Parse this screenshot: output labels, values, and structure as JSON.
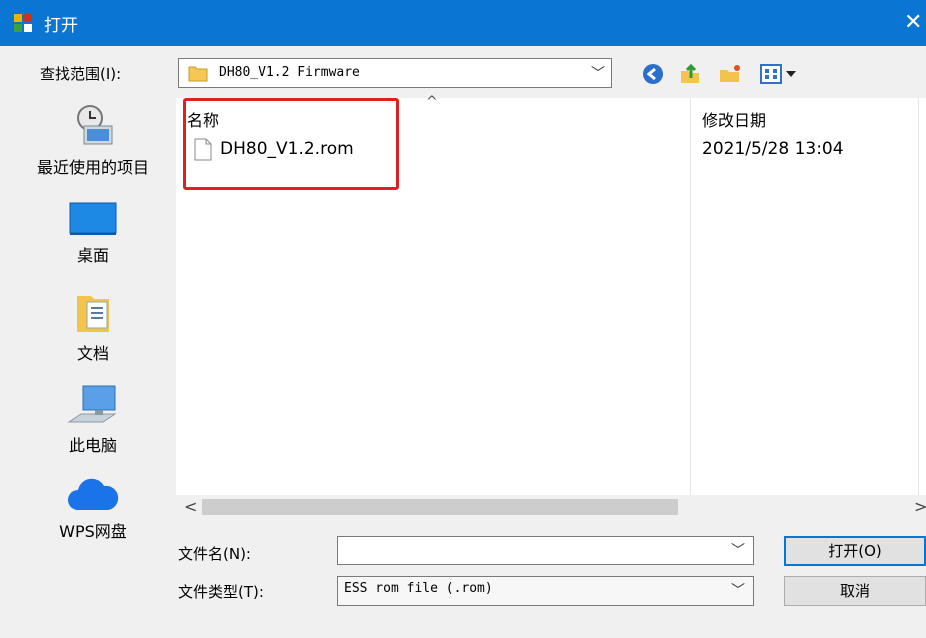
{
  "window": {
    "title": "打开",
    "close_glyph": "✕"
  },
  "toolbar": {
    "lookin_label": "查找范围(I):",
    "lookin_value": "DH80_V1.2 Firmware",
    "icons": [
      "back-icon",
      "up-folder-icon",
      "new-folder-icon",
      "view-menu-icon"
    ]
  },
  "places": [
    {
      "name": "recent",
      "label": "最近使用的项目",
      "icon": "recent-items-icon"
    },
    {
      "name": "desktop",
      "label": "桌面",
      "icon": "desktop-icon"
    },
    {
      "name": "documents",
      "label": "文档",
      "icon": "documents-icon"
    },
    {
      "name": "this-pc",
      "label": "此电脑",
      "icon": "computer-icon"
    },
    {
      "name": "wps",
      "label": "WPS网盘",
      "icon": "cloud-icon"
    }
  ],
  "filelist": {
    "columns": {
      "name": "名称",
      "date": "修改日期"
    },
    "sort_caret": "^",
    "rows": [
      {
        "name": "DH80_V1.2.rom",
        "date": "2021/5/28 13:04"
      }
    ]
  },
  "scroll": {
    "left": "<",
    "right": ">"
  },
  "filename": {
    "label": "文件名(N):",
    "value": ""
  },
  "filetype": {
    "label": "文件类型(T):",
    "value": "ESS rom file (.rom)"
  },
  "buttons": {
    "open": "打开(O)",
    "cancel": "取消"
  },
  "colors": {
    "titlebar": "#0b75d3",
    "highlight": "#e02020",
    "accent": "#0078d7"
  }
}
